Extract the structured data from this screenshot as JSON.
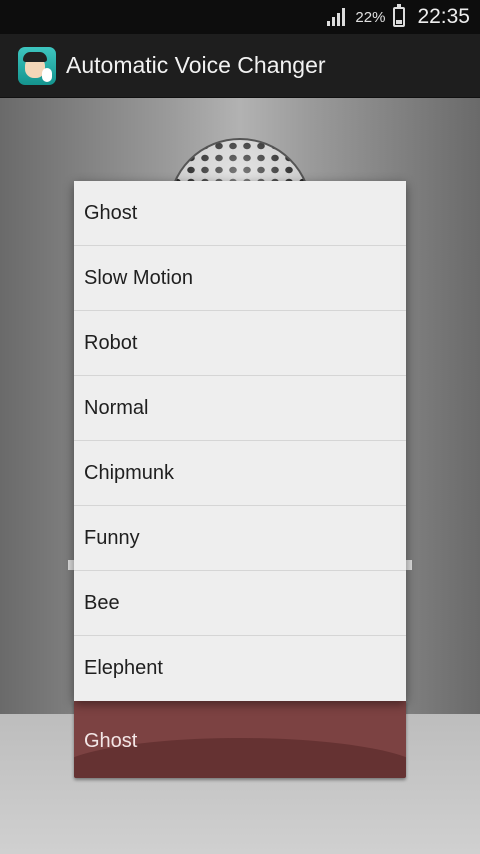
{
  "status_bar": {
    "battery_percent": "22%",
    "time": "22:35",
    "icons": [
      "signal-icon",
      "battery-icon"
    ]
  },
  "app_bar": {
    "title": "Automatic Voice Changer",
    "icon": "app-logo-icon"
  },
  "voice_menu": {
    "items": [
      "Ghost",
      "Slow Motion",
      "Robot",
      "Normal",
      "Chipmunk",
      "Funny",
      "Bee",
      "Elephent"
    ]
  },
  "spinner": {
    "selected": "Ghost",
    "accent_color": "#7c4242"
  }
}
